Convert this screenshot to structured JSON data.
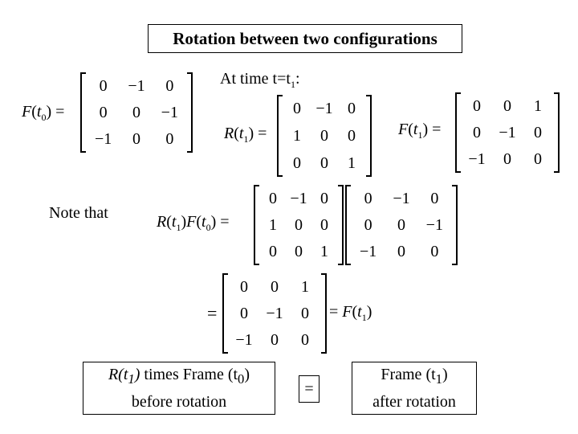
{
  "title": "Rotation between two configurations",
  "at_time_label": "At time t=t",
  "at_time_sub": "1",
  "at_time_colon": ":",
  "note_label": "Note that",
  "equals": "=",
  "F_t0": {
    "name": "F",
    "arg": "t",
    "sub": "0",
    "matrix": [
      [
        "0",
        "−1",
        "0"
      ],
      [
        "0",
        "0",
        "−1"
      ],
      [
        "−1",
        "0",
        "0"
      ]
    ]
  },
  "R_t1": {
    "name": "R",
    "arg": "t",
    "sub": "1",
    "matrix": [
      [
        "0",
        "−1",
        "0"
      ],
      [
        "1",
        "0",
        "0"
      ],
      [
        "0",
        "0",
        "1"
      ]
    ]
  },
  "F_t1": {
    "name": "F",
    "arg": "t",
    "sub": "1",
    "matrix": [
      [
        "0",
        "0",
        "1"
      ],
      [
        "0",
        "−1",
        "0"
      ],
      [
        "−1",
        "0",
        "0"
      ]
    ]
  },
  "product": {
    "lhs_R": "R",
    "lhs_F": "F",
    "sub1": "1",
    "sub0": "0",
    "arg": "t",
    "left_matrix": [
      [
        "0",
        "−1",
        "0"
      ],
      [
        "1",
        "0",
        "0"
      ],
      [
        "0",
        "0",
        "1"
      ]
    ],
    "right_matrix": [
      [
        "0",
        "−1",
        "0"
      ],
      [
        "0",
        "0",
        "−1"
      ],
      [
        "−1",
        "0",
        "0"
      ]
    ],
    "result_matrix": [
      [
        "0",
        "0",
        "1"
      ],
      [
        "0",
        "−1",
        "0"
      ],
      [
        "−1",
        "0",
        "0"
      ]
    ],
    "result_name": "F",
    "result_sub": "1"
  },
  "bottom": {
    "left_box": {
      "line1_R": "R(t",
      "line1_R_sub": "1",
      "line1_R_close": ")",
      "line1_rest": " times Frame (t",
      "line1_sub": "0",
      "line1_close": ")",
      "line2": "before rotation"
    },
    "middle_box": "=",
    "right_box": {
      "line1": "Frame (t",
      "line1_sub": "1",
      "line1_close": ")",
      "line2": "after rotation"
    }
  }
}
